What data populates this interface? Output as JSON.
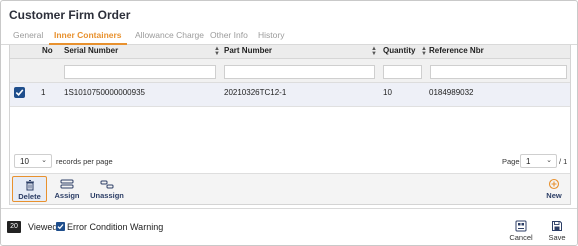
{
  "window": {
    "title": "Customer Firm Order"
  },
  "tabs": [
    {
      "label": "General"
    },
    {
      "label": "Inner Containers"
    },
    {
      "label": "Allowance Charge"
    },
    {
      "label": "Other Info"
    },
    {
      "label": "History"
    }
  ],
  "table": {
    "columns": [
      "No",
      "Serial Number",
      "Part Number",
      "Quantity",
      "Reference Nbr"
    ],
    "rows": [
      {
        "checked": true,
        "no": "1",
        "serial": "1S1010750000000935",
        "part": "20210326TC12-1",
        "quantity": "10",
        "reference": "0184989032"
      }
    ]
  },
  "pager": {
    "per_page_value": "10",
    "per_page_label": "records per page",
    "page_label": "Page",
    "page_value": "1",
    "total_pages": "/ 1"
  },
  "toolbar": {
    "delete": "Delete",
    "assign": "Assign",
    "unassign": "Unassign",
    "new": "New"
  },
  "status": {
    "count_badge": "20",
    "viewed_label": "Viewed",
    "error_label": "Error Condition Warning",
    "cancel": "Cancel",
    "save": "Save"
  },
  "colors": {
    "accent_orange": "#e8912e",
    "checkbox_blue": "#1f4e8c",
    "icon_navy": "#2c3e66"
  }
}
